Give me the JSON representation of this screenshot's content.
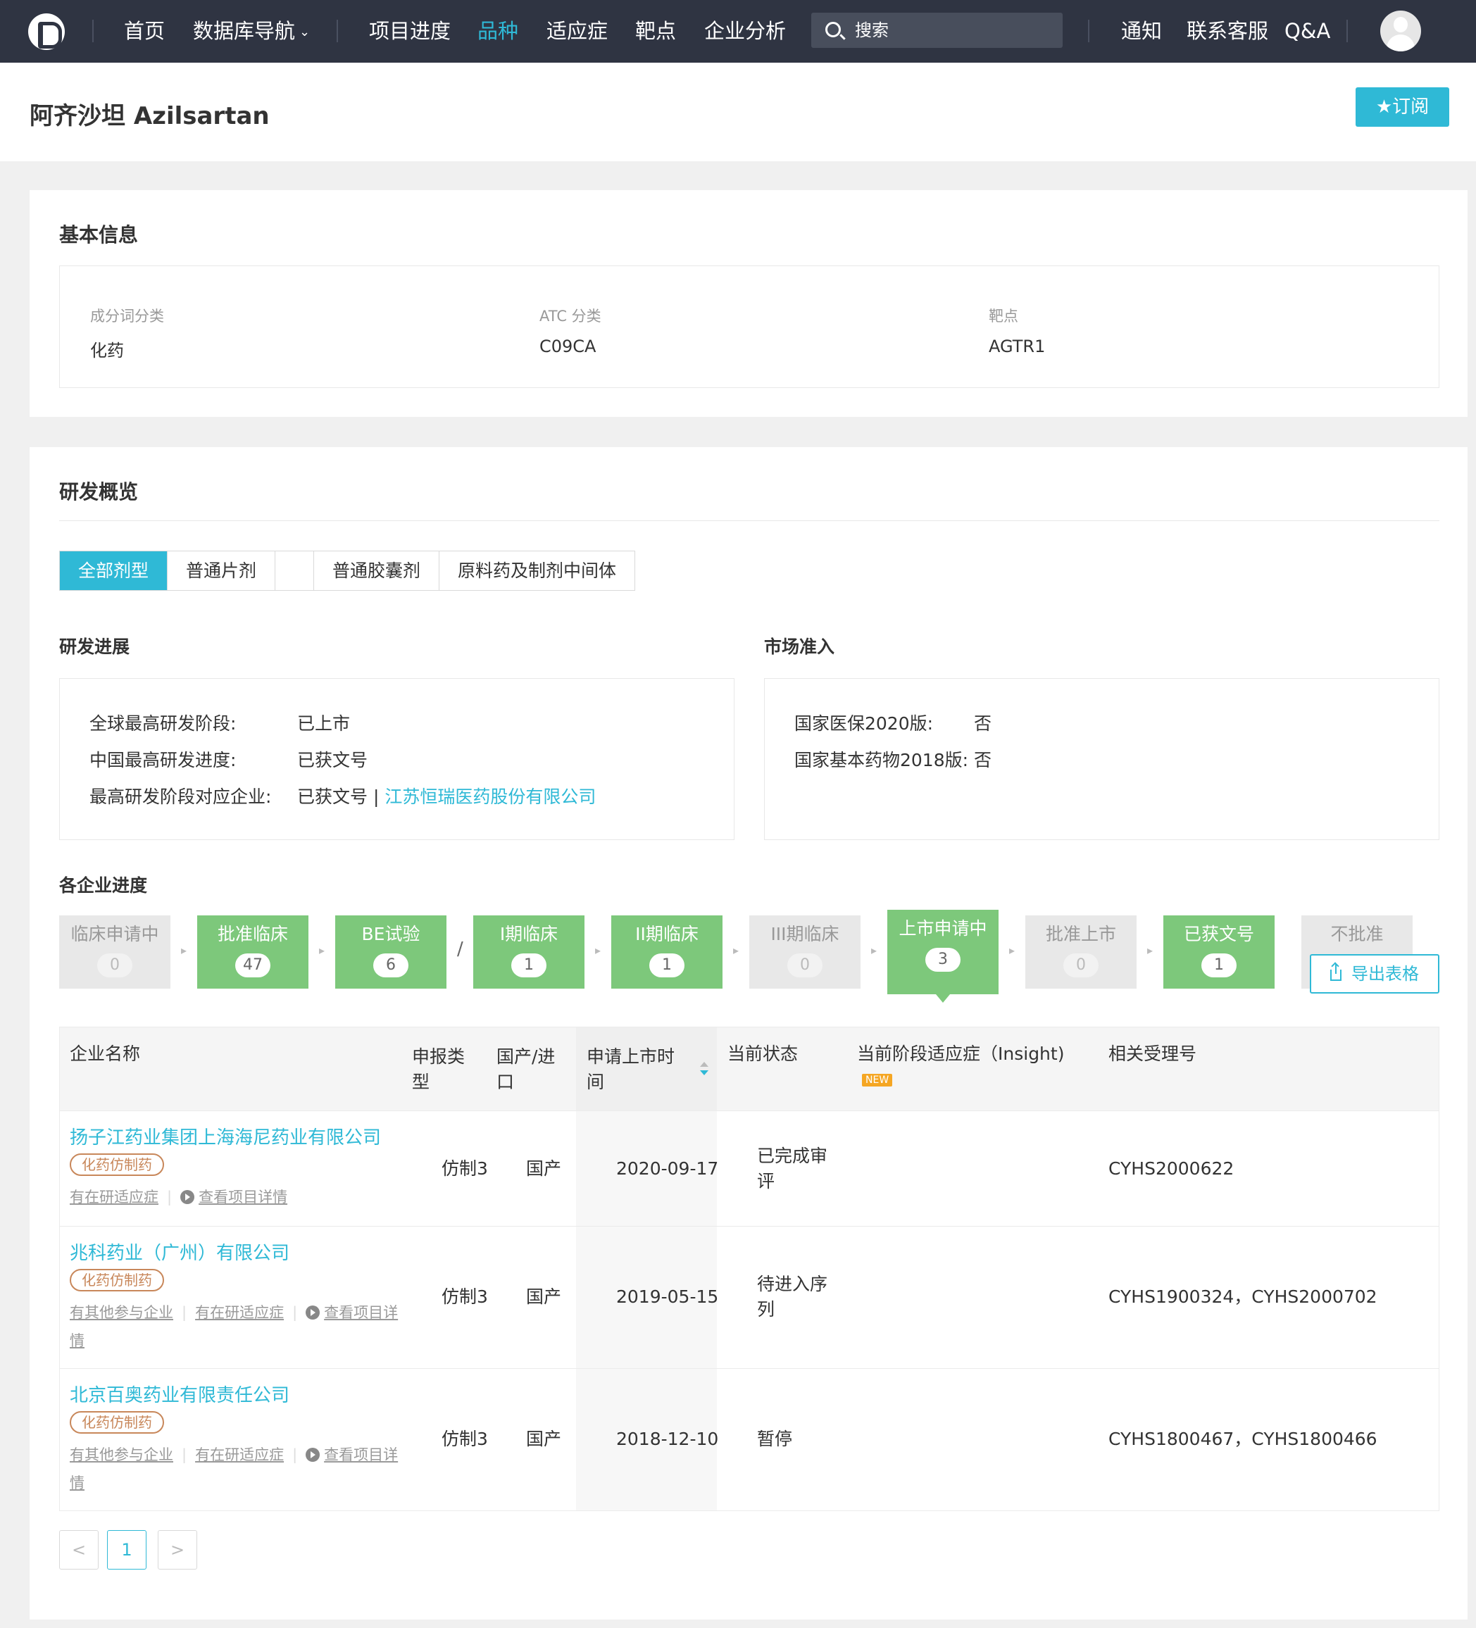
{
  "nav": {
    "items": [
      "首页",
      "数据库导航",
      "项目进度",
      "品种",
      "适应症",
      "靶点",
      "企业分析"
    ],
    "active": "品种",
    "search_placeholder": "搜索",
    "right": [
      "通知",
      "联系客服",
      "Q&A"
    ]
  },
  "page": {
    "title": "阿齐沙坦 Azilsartan",
    "subscribe_label": "★订阅"
  },
  "basic_info": {
    "title": "基本信息",
    "fields": [
      {
        "label": "成分词分类",
        "value": "化药"
      },
      {
        "label": "ATC 分类",
        "value": "C09CA"
      },
      {
        "label": "靶点",
        "value": "AGTR1"
      }
    ]
  },
  "overview": {
    "title": "研发概览",
    "tabs": [
      "全部剂型",
      "普通片剂",
      "",
      "普通胶囊剂",
      "原料药及制剂中间体"
    ],
    "active_tab": "全部剂型",
    "rd_progress": {
      "title": "研发进展",
      "rows": [
        {
          "label": "全球最高研发阶段:",
          "value": "已上市"
        },
        {
          "label": "中国最高研发进度:",
          "value": "已获文号"
        },
        {
          "label": "最高研发阶段对应企业:",
          "value": "已获文号 | ",
          "link": "江苏恒瑞医药股份有限公司"
        }
      ]
    },
    "market_access": {
      "title": "市场准入",
      "rows": [
        {
          "label": "国家医保2020版:",
          "value": "否"
        },
        {
          "label": "国家基本药物2018版:",
          "value": "否"
        }
      ]
    }
  },
  "company_progress": {
    "title": "各企业进度",
    "stages": [
      {
        "name": "临床申请中",
        "count": "0",
        "active": false
      },
      {
        "name": "批准临床",
        "count": "47",
        "active": true
      },
      {
        "name": "BE试验",
        "count": "6",
        "active": true
      },
      {
        "name": "I期临床",
        "count": "1",
        "active": true
      },
      {
        "name": "II期临床",
        "count": "1",
        "active": true
      },
      {
        "name": "III期临床",
        "count": "0",
        "active": false
      },
      {
        "name": "上市申请中",
        "count": "3",
        "active": true,
        "current": true
      },
      {
        "name": "批准上市",
        "count": "0",
        "active": false
      },
      {
        "name": "已获文号",
        "count": "1",
        "active": true
      },
      {
        "name": "不批准",
        "count": "",
        "active": false
      }
    ],
    "slash": "/",
    "export_label": "导出表格"
  },
  "table": {
    "headers": [
      "企业名称",
      "申报类\n型",
      "国产/进\n口",
      "申请上市时\n间",
      "当前状态",
      "当前阶段适应症（Insight)",
      "相关受理号"
    ],
    "new_badge": "NEW",
    "rows": [
      {
        "company": "扬子江药业集团上海海尼药业有限公司",
        "tag": "化药仿制药",
        "links": [
          "有在研适应症",
          "查看项目详情"
        ],
        "type": "仿制3",
        "origin": "国产",
        "date": "2020-09-17",
        "status": "已完成审\n评",
        "indication": "",
        "numbers": "CYHS2000622"
      },
      {
        "company": "兆科药业（广州）有限公司",
        "tag": "化药仿制药",
        "links": [
          "有其他参与企业",
          "有在研适应症",
          "查看项目详情"
        ],
        "type": "仿制3",
        "origin": "国产",
        "date": "2019-05-15",
        "status": "待进入序\n列",
        "indication": "",
        "numbers": "CYHS1900324，CYHS2000702"
      },
      {
        "company": "北京百奥药业有限责任公司",
        "tag": "化药仿制药",
        "links": [
          "有其他参与企业",
          "有在研适应症",
          "查看项目详情"
        ],
        "type": "仿制3",
        "origin": "国产",
        "date": "2018-12-10",
        "status": "暂停",
        "indication": "",
        "numbers": "CYHS1800467，CYHS1800466"
      }
    ]
  },
  "pagination": {
    "prev": "<",
    "page": "1",
    "next": ">"
  }
}
